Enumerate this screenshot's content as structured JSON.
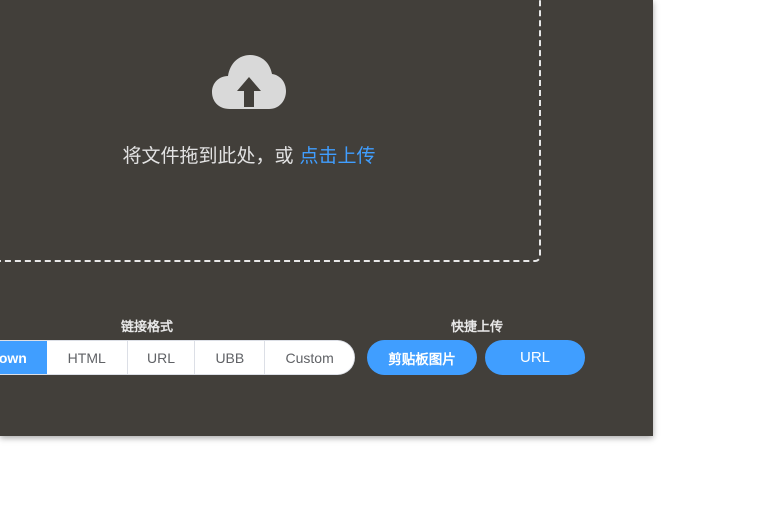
{
  "upload": {
    "drop_text": "将文件拖到此处，或 ",
    "drop_link": "点击上传",
    "icon": "cloud-upload-icon"
  },
  "link_format": {
    "label": "链接格式",
    "options": [
      "own",
      "HTML",
      "URL",
      "UBB",
      "Custom"
    ],
    "selected": "own"
  },
  "quick_upload": {
    "label": "快捷上传",
    "clipboard_label": "剪贴板图片",
    "url_label": "URL"
  },
  "colors": {
    "panel_bg": "#423f3a",
    "accent": "#409eff"
  }
}
